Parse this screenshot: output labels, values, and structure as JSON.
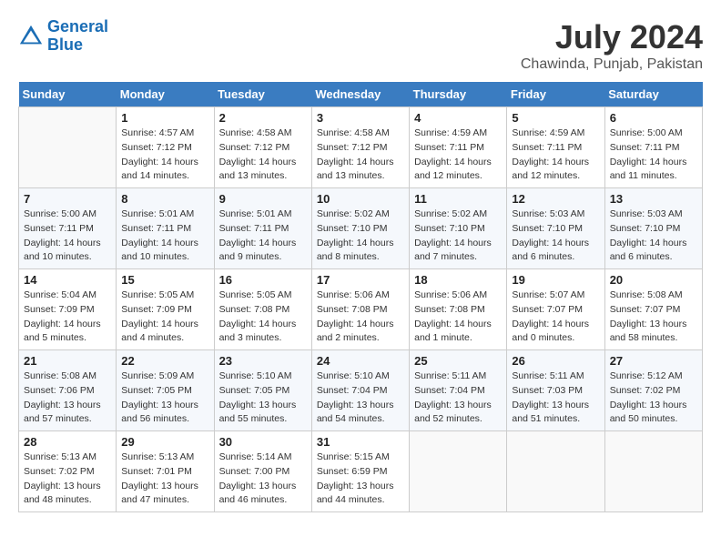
{
  "header": {
    "logo_line1": "General",
    "logo_line2": "Blue",
    "title": "July 2024",
    "subtitle": "Chawinda, Punjab, Pakistan"
  },
  "calendar": {
    "columns": [
      "Sunday",
      "Monday",
      "Tuesday",
      "Wednesday",
      "Thursday",
      "Friday",
      "Saturday"
    ],
    "rows": [
      [
        {
          "date": "",
          "info": ""
        },
        {
          "date": "1",
          "info": "Sunrise: 4:57 AM\nSunset: 7:12 PM\nDaylight: 14 hours\nand 14 minutes."
        },
        {
          "date": "2",
          "info": "Sunrise: 4:58 AM\nSunset: 7:12 PM\nDaylight: 14 hours\nand 13 minutes."
        },
        {
          "date": "3",
          "info": "Sunrise: 4:58 AM\nSunset: 7:12 PM\nDaylight: 14 hours\nand 13 minutes."
        },
        {
          "date": "4",
          "info": "Sunrise: 4:59 AM\nSunset: 7:11 PM\nDaylight: 14 hours\nand 12 minutes."
        },
        {
          "date": "5",
          "info": "Sunrise: 4:59 AM\nSunset: 7:11 PM\nDaylight: 14 hours\nand 12 minutes."
        },
        {
          "date": "6",
          "info": "Sunrise: 5:00 AM\nSunset: 7:11 PM\nDaylight: 14 hours\nand 11 minutes."
        }
      ],
      [
        {
          "date": "7",
          "info": "Sunrise: 5:00 AM\nSunset: 7:11 PM\nDaylight: 14 hours\nand 10 minutes."
        },
        {
          "date": "8",
          "info": "Sunrise: 5:01 AM\nSunset: 7:11 PM\nDaylight: 14 hours\nand 10 minutes."
        },
        {
          "date": "9",
          "info": "Sunrise: 5:01 AM\nSunset: 7:11 PM\nDaylight: 14 hours\nand 9 minutes."
        },
        {
          "date": "10",
          "info": "Sunrise: 5:02 AM\nSunset: 7:10 PM\nDaylight: 14 hours\nand 8 minutes."
        },
        {
          "date": "11",
          "info": "Sunrise: 5:02 AM\nSunset: 7:10 PM\nDaylight: 14 hours\nand 7 minutes."
        },
        {
          "date": "12",
          "info": "Sunrise: 5:03 AM\nSunset: 7:10 PM\nDaylight: 14 hours\nand 6 minutes."
        },
        {
          "date": "13",
          "info": "Sunrise: 5:03 AM\nSunset: 7:10 PM\nDaylight: 14 hours\nand 6 minutes."
        }
      ],
      [
        {
          "date": "14",
          "info": "Sunrise: 5:04 AM\nSunset: 7:09 PM\nDaylight: 14 hours\nand 5 minutes."
        },
        {
          "date": "15",
          "info": "Sunrise: 5:05 AM\nSunset: 7:09 PM\nDaylight: 14 hours\nand 4 minutes."
        },
        {
          "date": "16",
          "info": "Sunrise: 5:05 AM\nSunset: 7:08 PM\nDaylight: 14 hours\nand 3 minutes."
        },
        {
          "date": "17",
          "info": "Sunrise: 5:06 AM\nSunset: 7:08 PM\nDaylight: 14 hours\nand 2 minutes."
        },
        {
          "date": "18",
          "info": "Sunrise: 5:06 AM\nSunset: 7:08 PM\nDaylight: 14 hours\nand 1 minute."
        },
        {
          "date": "19",
          "info": "Sunrise: 5:07 AM\nSunset: 7:07 PM\nDaylight: 14 hours\nand 0 minutes."
        },
        {
          "date": "20",
          "info": "Sunrise: 5:08 AM\nSunset: 7:07 PM\nDaylight: 13 hours\nand 58 minutes."
        }
      ],
      [
        {
          "date": "21",
          "info": "Sunrise: 5:08 AM\nSunset: 7:06 PM\nDaylight: 13 hours\nand 57 minutes."
        },
        {
          "date": "22",
          "info": "Sunrise: 5:09 AM\nSunset: 7:05 PM\nDaylight: 13 hours\nand 56 minutes."
        },
        {
          "date": "23",
          "info": "Sunrise: 5:10 AM\nSunset: 7:05 PM\nDaylight: 13 hours\nand 55 minutes."
        },
        {
          "date": "24",
          "info": "Sunrise: 5:10 AM\nSunset: 7:04 PM\nDaylight: 13 hours\nand 54 minutes."
        },
        {
          "date": "25",
          "info": "Sunrise: 5:11 AM\nSunset: 7:04 PM\nDaylight: 13 hours\nand 52 minutes."
        },
        {
          "date": "26",
          "info": "Sunrise: 5:11 AM\nSunset: 7:03 PM\nDaylight: 13 hours\nand 51 minutes."
        },
        {
          "date": "27",
          "info": "Sunrise: 5:12 AM\nSunset: 7:02 PM\nDaylight: 13 hours\nand 50 minutes."
        }
      ],
      [
        {
          "date": "28",
          "info": "Sunrise: 5:13 AM\nSunset: 7:02 PM\nDaylight: 13 hours\nand 48 minutes."
        },
        {
          "date": "29",
          "info": "Sunrise: 5:13 AM\nSunset: 7:01 PM\nDaylight: 13 hours\nand 47 minutes."
        },
        {
          "date": "30",
          "info": "Sunrise: 5:14 AM\nSunset: 7:00 PM\nDaylight: 13 hours\nand 46 minutes."
        },
        {
          "date": "31",
          "info": "Sunrise: 5:15 AM\nSunset: 6:59 PM\nDaylight: 13 hours\nand 44 minutes."
        },
        {
          "date": "",
          "info": ""
        },
        {
          "date": "",
          "info": ""
        },
        {
          "date": "",
          "info": ""
        }
      ]
    ]
  }
}
